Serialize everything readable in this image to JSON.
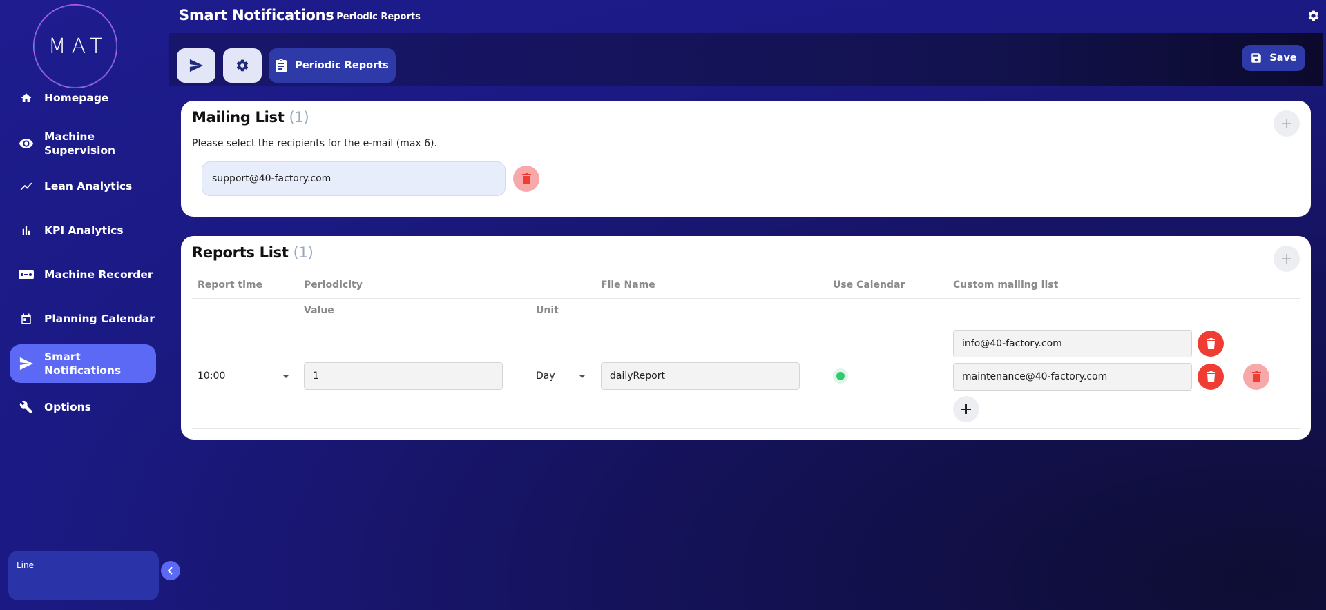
{
  "sidebar": {
    "logo": "MAT",
    "items": [
      {
        "label": "Homepage",
        "icon": "home-icon"
      },
      {
        "label": "Machine Supervision",
        "icon": "eye-icon"
      },
      {
        "label": "Lean Analytics",
        "icon": "trend-line-icon"
      },
      {
        "label": "KPI Analytics",
        "icon": "bar-chart-icon"
      },
      {
        "label": "Machine Recorder",
        "icon": "recorder-icon"
      },
      {
        "label": "Planning Calendar",
        "icon": "calendar-icon"
      },
      {
        "label": "Smart Notifications",
        "icon": "send-icon",
        "active": true
      },
      {
        "label": "Options",
        "icon": "wrench-icon"
      }
    ],
    "line_label": "Line"
  },
  "header": {
    "title": "Smart Notifications",
    "breadcrumb": "/ Periodic Reports"
  },
  "toolbar": {
    "tab_label": "Periodic Reports",
    "save_label": "Save"
  },
  "mailing": {
    "title": "Mailing List",
    "count": "(1)",
    "hint": "Please select the recipients for the e-mail (max 6).",
    "emails": [
      "support@40-factory.com"
    ]
  },
  "reports": {
    "title": "Reports List",
    "count": "(1)",
    "headers": {
      "report_time": "Report time",
      "periodicity": "Periodicity",
      "value": "Value",
      "unit": "Unit",
      "file_name": "File Name",
      "use_calendar": "Use Calendar",
      "custom_mailing": "Custom mailing list"
    },
    "rows": [
      {
        "time": "10:00",
        "value": "1",
        "unit": "Day",
        "file_name": "dailyReport",
        "use_calendar": true,
        "emails": [
          "info@40-factory.com",
          "maintenance@40-factory.com"
        ]
      }
    ]
  },
  "colors": {
    "accent": "#5b69f4",
    "danger": "#ef3d33",
    "danger_light": "#f7a8a8",
    "success": "#2ecc71"
  }
}
